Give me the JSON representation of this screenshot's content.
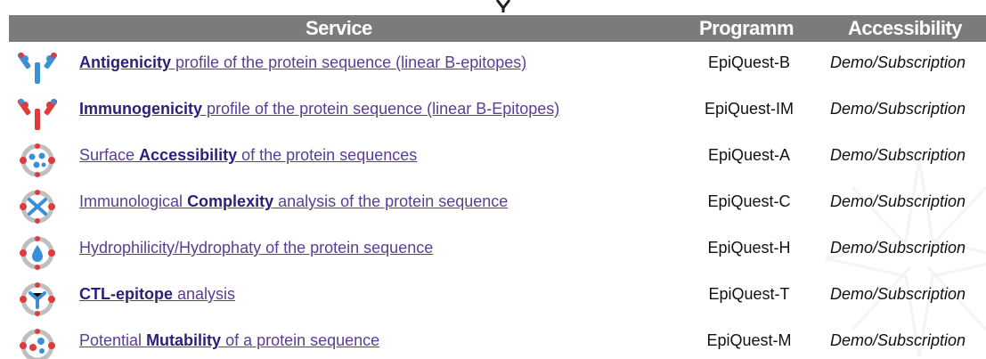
{
  "table": {
    "headers": {
      "service": "Service",
      "program": "Programm",
      "accessibility": "Accessibility"
    },
    "rows": [
      {
        "icon": "antibody-blue-icon",
        "pre": "",
        "bold": "Antigenicity",
        "post": " profile of the protein sequence (linear B-epitopes)",
        "program": "EpiQuest-B",
        "access": "Demo/Subscription"
      },
      {
        "icon": "antibody-red-icon",
        "pre": "",
        "bold": "Immunogenicity",
        "post": " profile of the protein sequence (linear B-Epitopes)",
        "program": "EpiQuest-IM",
        "access": "Demo/Subscription"
      },
      {
        "icon": "surface-accessibility-icon",
        "pre": "Surface ",
        "bold": "Accessibility",
        "post": " of the protein sequences",
        "program": "EpiQuest-A",
        "access": "Demo/Subscription"
      },
      {
        "icon": "complexity-icon",
        "pre": "Immunological ",
        "bold": "Complexity",
        "post": " analysis of the protein sequence",
        "program": "EpiQuest-C",
        "access": "Demo/Subscription"
      },
      {
        "icon": "hydrophilicity-drop-icon",
        "pre": "",
        "bold": "",
        "post": "Hydrophilicity/Hydrophaty of the protein sequence",
        "program": "EpiQuest-H",
        "access": "Demo/Subscription"
      },
      {
        "icon": "ctl-epitope-icon",
        "pre": "",
        "bold": "CTL-epitope",
        "post": " analysis",
        "program": "EpiQuest-T",
        "access": "Demo/Subscription"
      },
      {
        "icon": "mutability-icon",
        "pre": "Potential ",
        "bold": "Mutability",
        "post": " of a protein sequence",
        "program": "EpiQuest-M",
        "access": "Demo/Subscription"
      }
    ]
  },
  "colors": {
    "header_bg": "#7b7b7b",
    "link": "#5a3d96",
    "link_bold": "#2d1e7a",
    "icon_blue": "#3a8fd6",
    "icon_red": "#e03a3a"
  }
}
